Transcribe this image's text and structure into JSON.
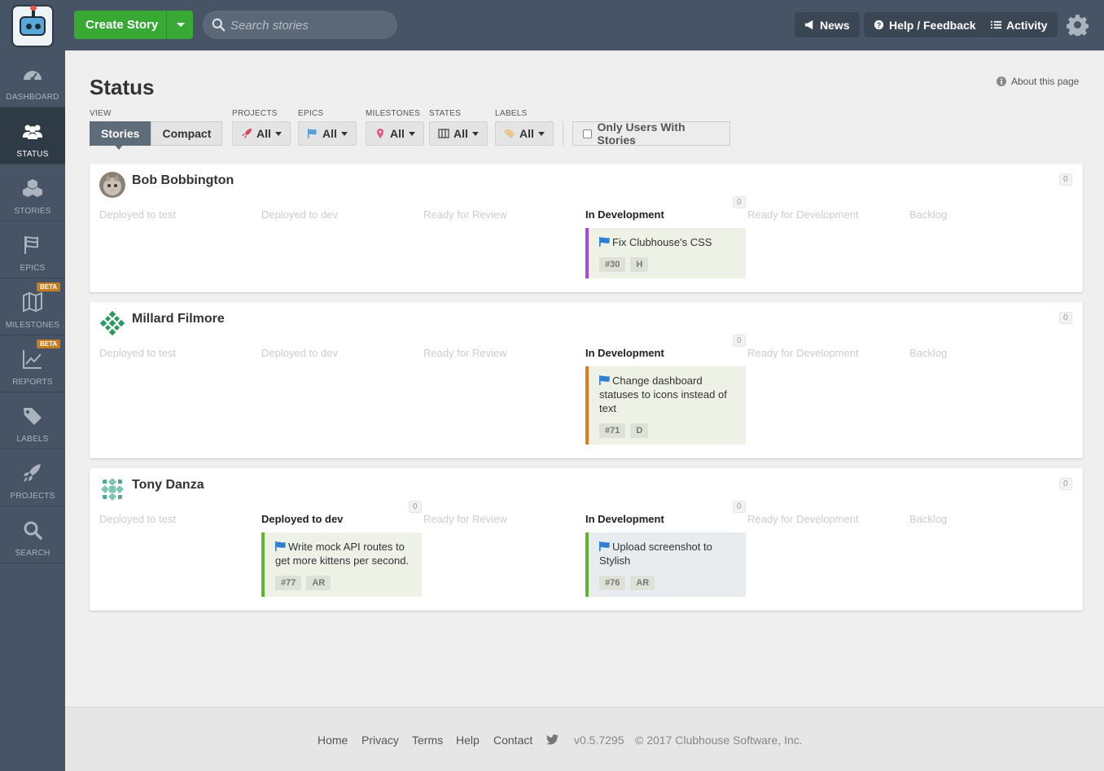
{
  "topbar": {
    "create_label": "Create Story",
    "search_placeholder": "Search stories",
    "news_label": "News",
    "help_label": "Help / Feedback",
    "activity_label": "Activity"
  },
  "sidebar": {
    "items": [
      {
        "label": "DASHBOARD"
      },
      {
        "label": "STATUS"
      },
      {
        "label": "STORIES"
      },
      {
        "label": "EPICS"
      },
      {
        "label": "MILESTONES",
        "badge": "BETA"
      },
      {
        "label": "REPORTS",
        "badge": "BETA"
      },
      {
        "label": "LABELS"
      },
      {
        "label": "PROJECTS"
      },
      {
        "label": "SEARCH"
      }
    ]
  },
  "page": {
    "title": "Status",
    "about": "About this page",
    "filters": {
      "view_label": "VIEW",
      "view_options": [
        "Stories",
        "Compact"
      ],
      "projects_label": "PROJECTS",
      "epics_label": "EPICS",
      "milestones_label": "MILESTONES",
      "states_label": "STATES",
      "labels_label": "LABELS",
      "all": "All",
      "only_users": "Only Users With Stories"
    }
  },
  "columns": [
    "Deployed to test",
    "Deployed to dev",
    "Ready for Review",
    "In Development",
    "Ready for Development",
    "Backlog"
  ],
  "users": [
    {
      "name": "Bob Bobbington",
      "count": "0",
      "active_count": "0",
      "story": {
        "title": "Fix Clubhouse's CSS",
        "id": "#30",
        "owner": "H"
      }
    },
    {
      "name": "Millard Filmore",
      "count": "0",
      "active_count": "0",
      "story": {
        "title": "Change dashboard statuses to icons instead of text",
        "id": "#71",
        "owner": "D"
      }
    },
    {
      "name": "Tony Danza",
      "count": "0",
      "dev_count": "0",
      "active_count": "0",
      "dev_story": {
        "title": "Write mock API routes to get more kittens per second.",
        "id": "#77",
        "owner": "AR"
      },
      "story": {
        "title": "Upload screenshot to Stylish",
        "id": "#76",
        "owner": "AR"
      }
    }
  ],
  "colors": {
    "topbar": "#465465",
    "create": "#39a935",
    "story_purple": "#ab47e0",
    "story_orange": "#e07a1f",
    "story_green": "#5cb82a"
  },
  "footer": {
    "links": [
      "Home",
      "Privacy",
      "Terms",
      "Help",
      "Contact"
    ],
    "version": "v0.5.7295",
    "copyright": "© 2017 Clubhouse Software, Inc."
  }
}
